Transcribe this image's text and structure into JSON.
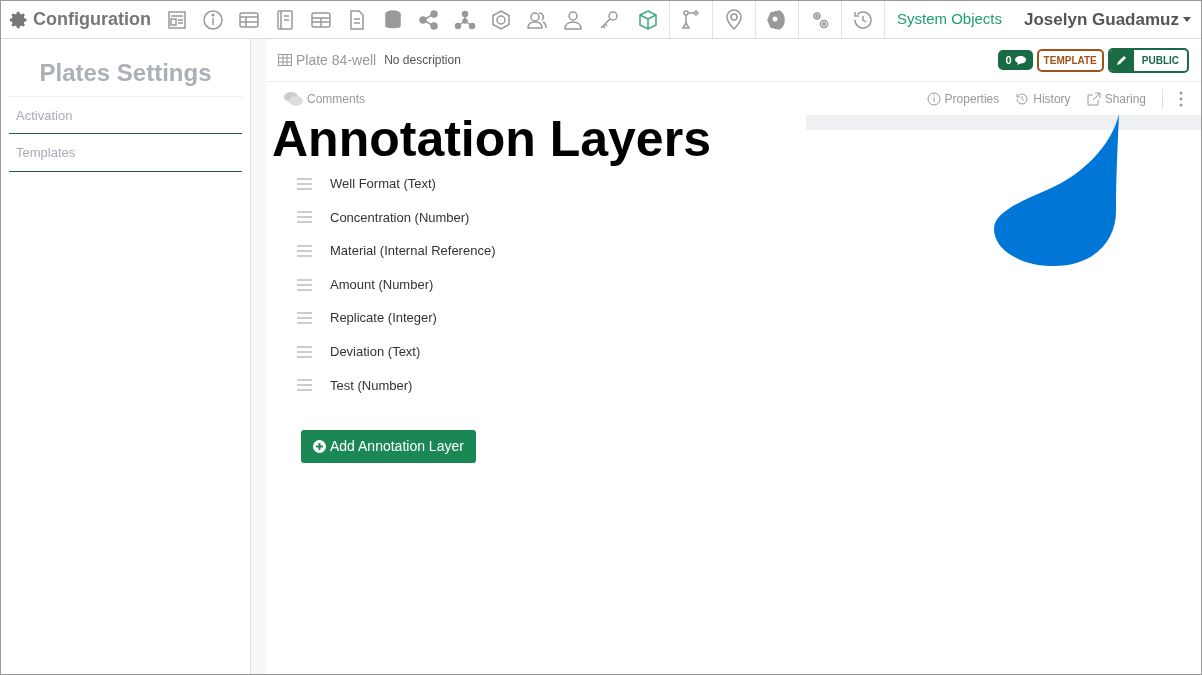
{
  "app": {
    "title": "Configuration"
  },
  "toolbar_icons": [
    {
      "selected": false
    },
    {
      "selected": false
    },
    {
      "selected": false
    },
    {
      "selected": false
    },
    {
      "selected": false
    },
    {
      "selected": false
    },
    {
      "selected": false
    },
    {
      "selected": false
    },
    {
      "selected": false
    },
    {
      "selected": false
    },
    {
      "selected": false
    },
    {
      "selected": false
    },
    {
      "selected": false
    },
    {
      "selected": true
    },
    {
      "selected": false
    },
    {
      "selected": false
    },
    {
      "selected": false
    },
    {
      "selected": false
    },
    {
      "selected": false
    }
  ],
  "system_objects_link": "System Objects",
  "user": {
    "name": "Joselyn Guadamuz"
  },
  "sidebar": {
    "title": "Plates Settings",
    "items": [
      {
        "label": "Activation"
      },
      {
        "label": "Templates"
      }
    ]
  },
  "record": {
    "name": "Plate 84-well",
    "description": "No description",
    "comment_count": "0",
    "template_badge": "TEMPLATE",
    "visibility": "PUBLIC"
  },
  "tabs": {
    "left": [
      {
        "label": "Comments"
      }
    ],
    "right": [
      {
        "label": "Properties"
      },
      {
        "label": "History"
      },
      {
        "label": "Sharing"
      }
    ]
  },
  "heading": "Annotation Layers",
  "layers": [
    {
      "label": "Well Format (Text)"
    },
    {
      "label": "Concentration (Number)"
    },
    {
      "label": "Material (Internal Reference)"
    },
    {
      "label": "Amount (Number)"
    },
    {
      "label": "Replicate (Integer)"
    },
    {
      "label": "Deviation (Text)"
    },
    {
      "label": "Test (Number)"
    }
  ],
  "add_button": "Add Annotation Layer"
}
